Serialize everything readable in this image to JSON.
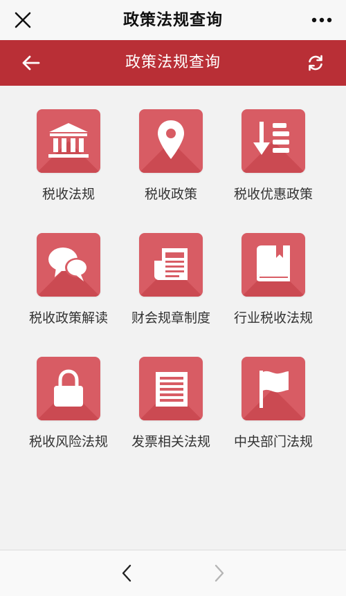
{
  "window": {
    "title": "政策法规查询",
    "close_icon": "close-icon",
    "more_icon": "more-dots-icon"
  },
  "header": {
    "title": "政策法规查询",
    "back_icon": "arrow-left-icon",
    "refresh_icon": "refresh-icon",
    "background": "#b92f36"
  },
  "tiles": [
    {
      "label": "税收法规",
      "icon": "bank-building-icon"
    },
    {
      "label": "税收政策",
      "icon": "map-pin-icon"
    },
    {
      "label": "税收优惠政策",
      "icon": "sort-descending-list-icon"
    },
    {
      "label": "税收政策解读",
      "icon": "chat-bubbles-icon"
    },
    {
      "label": "财会规章制度",
      "icon": "newspaper-icon"
    },
    {
      "label": "行业税收法规",
      "icon": "book-bookmark-icon"
    },
    {
      "label": "税收风险法规",
      "icon": "padlock-icon"
    },
    {
      "label": "发票相关法规",
      "icon": "document-lines-icon"
    },
    {
      "label": "中央部门法规",
      "icon": "flag-icon"
    }
  ],
  "colors": {
    "tile": "#d85c64",
    "tile_shadow": "#c9474f"
  },
  "bottom_nav": {
    "back_icon": "chevron-left-icon",
    "forward_icon": "chevron-right-icon"
  }
}
